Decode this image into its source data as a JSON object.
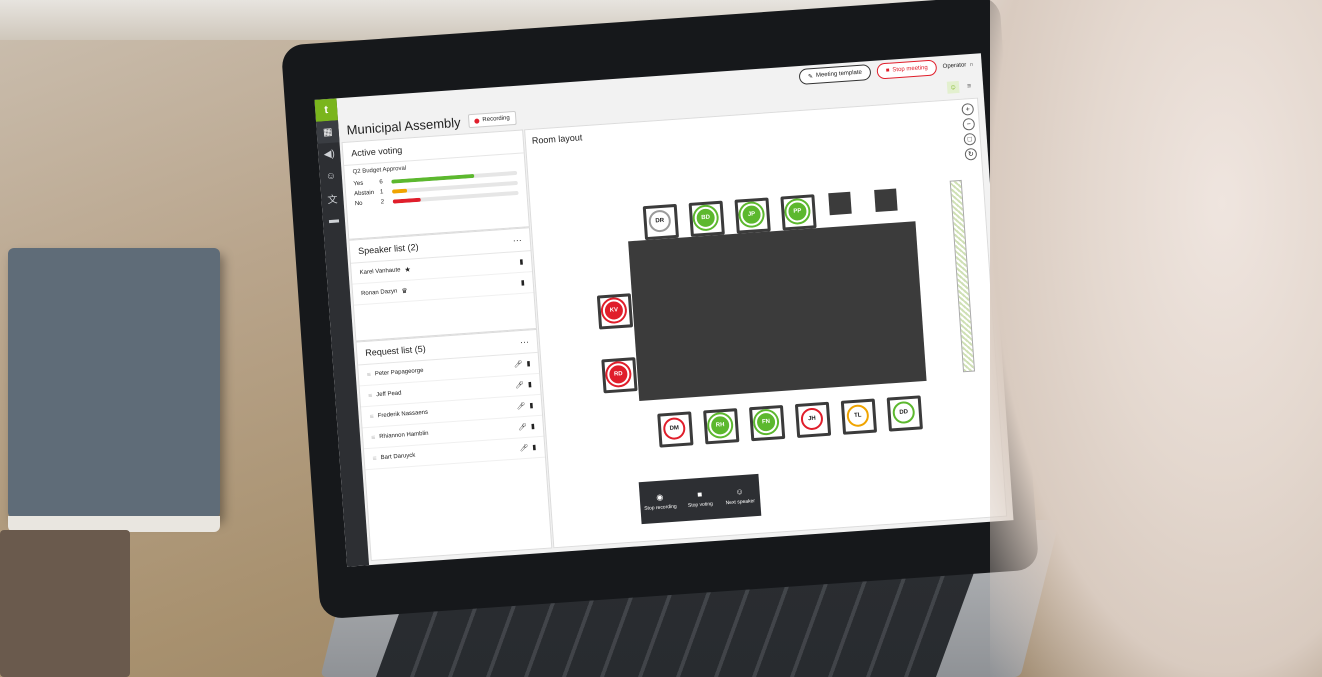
{
  "app": {
    "title": "Municipal Assembly",
    "recording_label": "Recording"
  },
  "toolbar": {
    "meeting_template": "Meeting template",
    "stop_meeting": "Stop meeting",
    "operator": "Operator"
  },
  "colors": {
    "accent": "#7ab51d",
    "danger": "#e01e2b",
    "warning": "#f0a400"
  },
  "voting": {
    "title": "Active voting",
    "item": "Q2 Budget Approval",
    "rows": [
      {
        "label": "Yes",
        "count": "6",
        "fraction": 0.66,
        "color": "#5cb82e"
      },
      {
        "label": "Abstain",
        "count": "1",
        "fraction": 0.12,
        "color": "#f0a400"
      },
      {
        "label": "No",
        "count": "2",
        "fraction": 0.22,
        "color": "#e01e2b"
      }
    ]
  },
  "speaker_list": {
    "title": "Speaker list",
    "count": "(2)",
    "items": [
      {
        "name": "Karel Vanhaute"
      },
      {
        "name": "Ronan Dazyn"
      }
    ]
  },
  "request_list": {
    "title": "Request list",
    "count": "(5)",
    "items": [
      {
        "name": "Peter Papageorge"
      },
      {
        "name": "Jeff Pead"
      },
      {
        "name": "Frederik Nassaens"
      },
      {
        "name": "Rhiannon Hamblin"
      },
      {
        "name": "Bart Daruyck"
      }
    ]
  },
  "room": {
    "title": "Room layout",
    "top_seats": [
      {
        "initials": "DR",
        "style": "ring-gray"
      },
      {
        "initials": "BD",
        "style": "green"
      },
      {
        "initials": "JP",
        "style": "green"
      },
      {
        "initials": "PP",
        "style": "green"
      }
    ],
    "left_seats": [
      {
        "initials": "KV",
        "style": "red"
      },
      {
        "initials": "RD",
        "style": "red"
      }
    ],
    "bottom_seats": [
      {
        "initials": "DM",
        "style": "ring-red"
      },
      {
        "initials": "RH",
        "style": "green"
      },
      {
        "initials": "FN",
        "style": "green"
      },
      {
        "initials": "JH",
        "style": "ring-red"
      },
      {
        "initials": "TL",
        "style": "ring-amber"
      },
      {
        "initials": "DD",
        "style": "ring-green"
      }
    ]
  },
  "actions": {
    "stop_recording": "Stop recording",
    "stop_voting": "Stop voting",
    "next_speaker": "Next speaker"
  }
}
